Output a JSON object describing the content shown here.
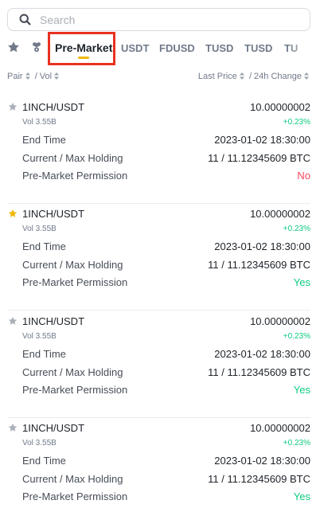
{
  "search": {
    "placeholder": "Search"
  },
  "tabs": {
    "items": [
      "Pre-Market",
      "USDT",
      "FDUSD",
      "TUSD",
      "TUSD",
      "TU"
    ],
    "active": "Pre-Market"
  },
  "sort": {
    "pair": "Pair",
    "vol": "/ Vol",
    "last_price": "Last Price",
    "change": "/ 24h Change"
  },
  "labels": {
    "end_time": "End Time",
    "holding": "Current / Max Holding",
    "permission": "Pre-Market Permission"
  },
  "colors": {
    "accent": "#f0b90b",
    "up": "#0ecb81",
    "down": "#f6465d",
    "highlight_box": "#e8321f"
  },
  "rows": [
    {
      "pair": "1INCH/USDT",
      "price": "10.00000002",
      "vol": "Vol 3.55B",
      "change": "+0.23%",
      "end_time": "2023-01-02 18:30:00",
      "holding": "11 / 11.12345609 BTC",
      "permission": "No",
      "starred": false
    },
    {
      "pair": "1INCH/USDT",
      "price": "10.00000002",
      "vol": "Vol 3.55B",
      "change": "+0.23%",
      "end_time": "2023-01-02 18:30:00",
      "holding": "11 / 11.12345609 BTC",
      "permission": "Yes",
      "starred": true
    },
    {
      "pair": "1INCH/USDT",
      "price": "10.00000002",
      "vol": "Vol 3.55B",
      "change": "+0.23%",
      "end_time": "2023-01-02 18:30:00",
      "holding": "11 / 11.12345609 BTC",
      "permission": "Yes",
      "starred": false
    },
    {
      "pair": "1INCH/USDT",
      "price": "10.00000002",
      "vol": "Vol 3.55B",
      "change": "+0.23%",
      "end_time": "2023-01-02 18:30:00",
      "holding": "11 / 11.12345609 BTC",
      "permission": "Yes",
      "starred": false
    }
  ]
}
